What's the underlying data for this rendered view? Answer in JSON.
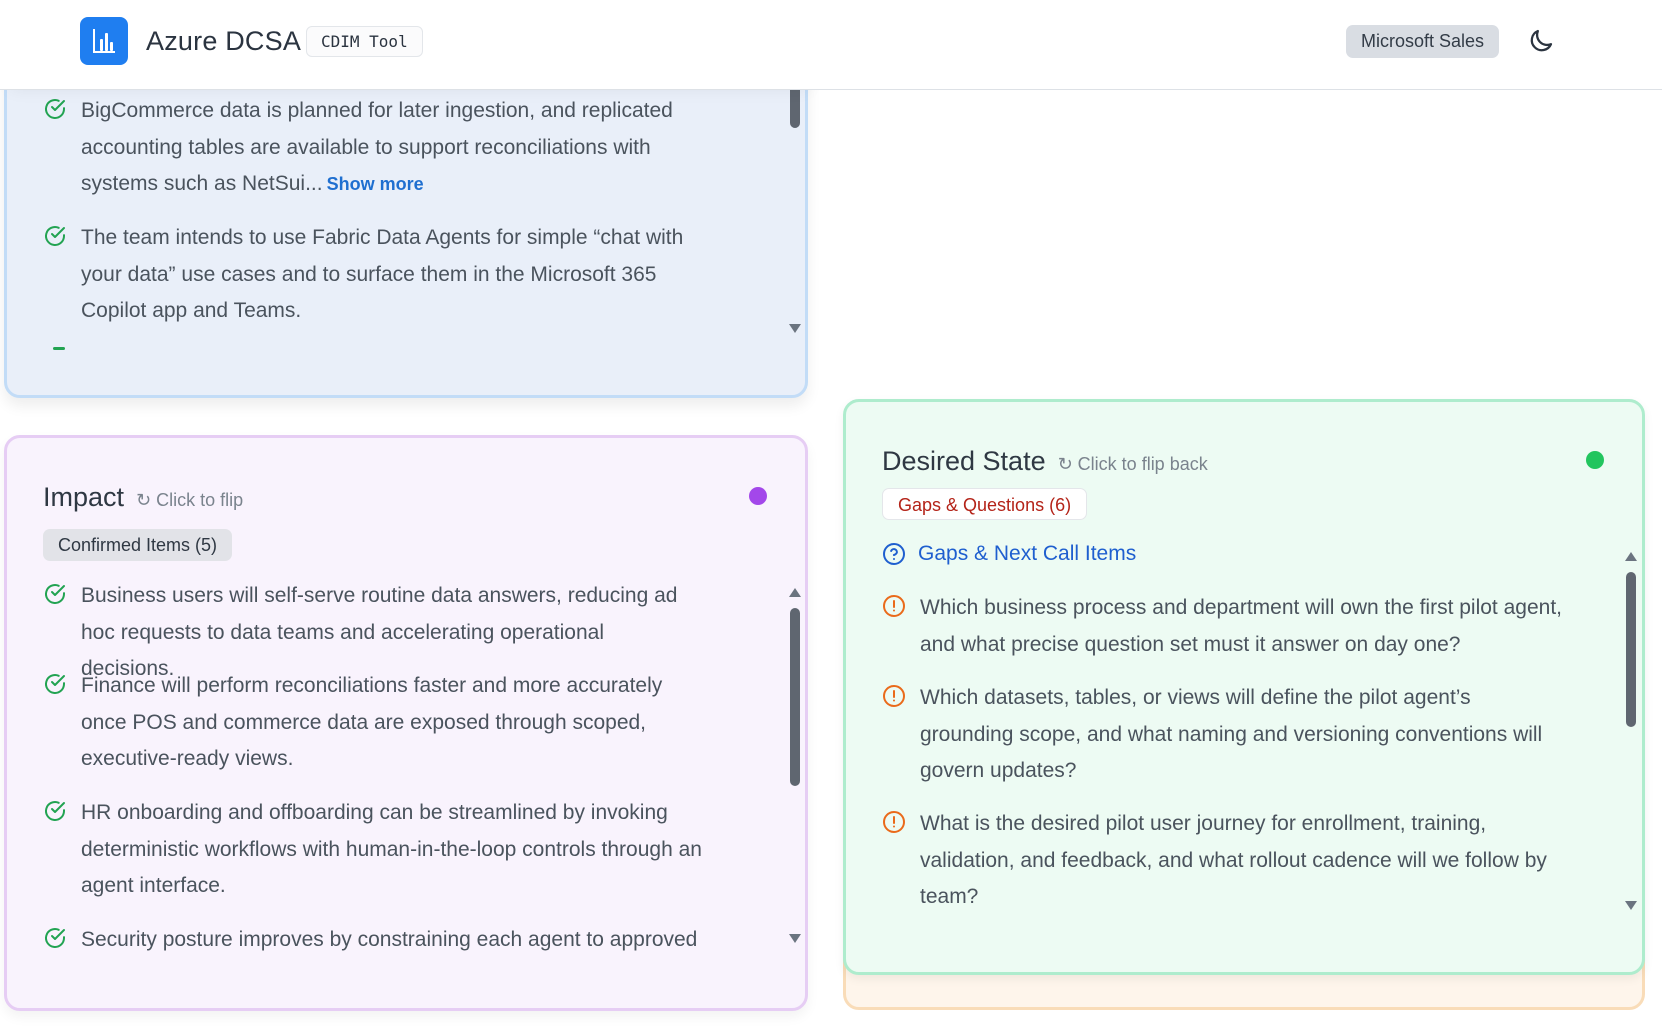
{
  "header": {
    "app_title": "Azure DCSA",
    "tool_badge": "CDIM Tool",
    "sales_badge": "Microsoft Sales",
    "theme_icon": "moon-icon",
    "logo_icon": "bar-chart-icon"
  },
  "top_card": {
    "items": [
      {
        "text": "BigCommerce data is planned for later ingestion, and replicated accounting tables are available to support reconciliations with systems such as NetSui...",
        "show_more": "Show more"
      },
      {
        "text": "The team intends to use Fabric Data Agents for simple “chat with your data” use cases and to surface them in the Microsoft 365 Copilot app and Teams."
      }
    ]
  },
  "impact_card": {
    "title": "Impact",
    "flip_hint": "↻ Click to flip",
    "accent_color": "#a347ea",
    "tab_label": "Confirmed Items (5)",
    "items": [
      "Business users will self-serve routine data answers, reducing ad hoc requests to data teams and accelerating operational decisions.",
      "Finance will perform reconciliations faster and more accurately once POS and commerce data are exposed through scoped, executive-ready views.",
      "HR onboarding and offboarding can be streamlined by invoking deterministic workflows with human-in-the-loop controls through an agent interface.",
      "Security posture improves by constraining each agent to approved"
    ]
  },
  "desired_card": {
    "title": "Desired State",
    "flip_hint": "↻ Click to flip back",
    "accent_color": "#22c55e",
    "tab_label": "Gaps & Questions (6)",
    "section_label": "Gaps & Next Call Items",
    "items": [
      "Which business process and department will own the first pilot agent, and what precise question set must it answer on day one?",
      "Which datasets, tables, or views will define the pilot agent’s grounding scope, and what naming and versioning conventions will govern updates?",
      "What is the desired pilot user journey for enrollment, training, validation, and feedback, and what rollout cadence will we follow by team?"
    ]
  }
}
